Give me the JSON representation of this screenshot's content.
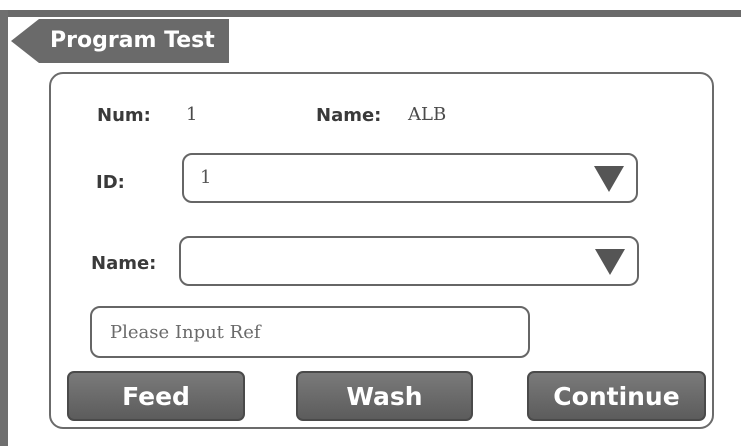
{
  "header": {
    "title": "Program Test"
  },
  "info": {
    "num_label": "Num:",
    "num_value": "1",
    "name_label": "Name:",
    "name_value": "ALB"
  },
  "id_field": {
    "label": "ID:",
    "value": "1"
  },
  "name_field": {
    "label": "Name:",
    "value": ""
  },
  "ref_input": {
    "placeholder": "Please Input Ref",
    "value": ""
  },
  "buttons": {
    "feed": "Feed",
    "wash": "Wash",
    "continue": "Continue"
  },
  "icons": {
    "dropdown": "triangle-down-icon",
    "back": "back-arrow-icon"
  }
}
